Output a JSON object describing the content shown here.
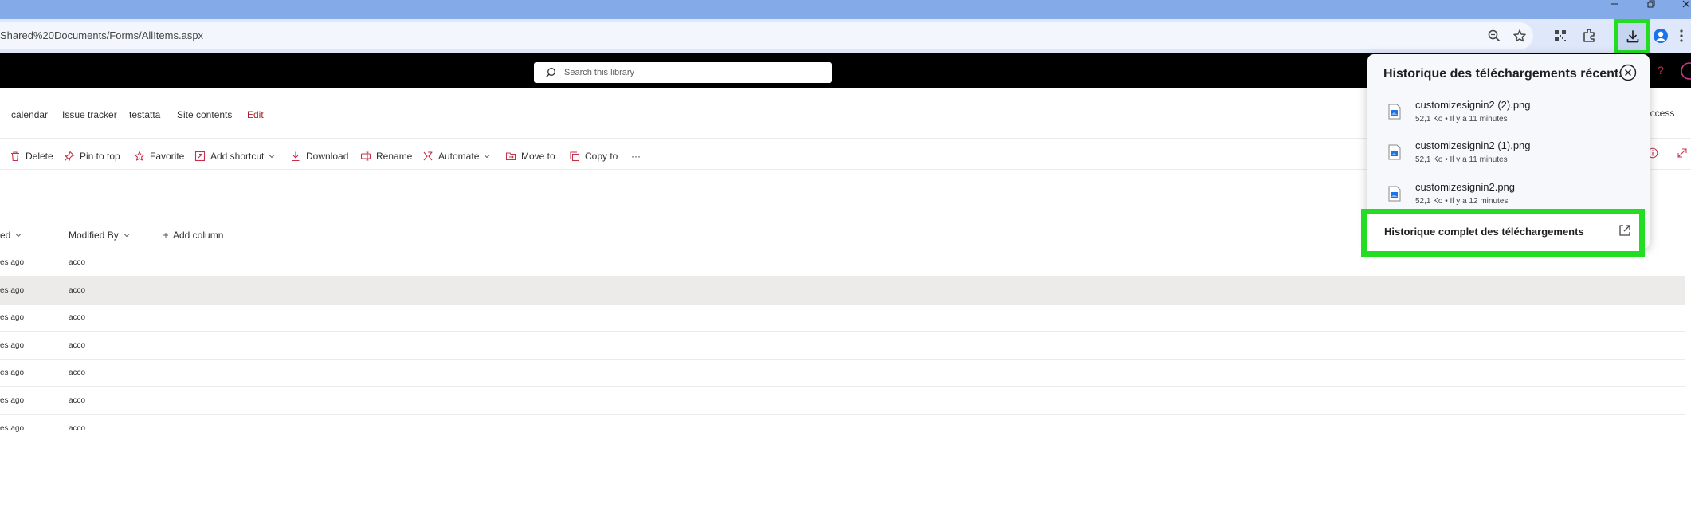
{
  "browser": {
    "url": "Shared%20Documents/Forms/AllItems.aspx",
    "window_controls": [
      "minimize",
      "restore",
      "close"
    ],
    "accent_highlight": "#22dd22"
  },
  "suite_bar": {
    "search_placeholder": "Search this library"
  },
  "site_nav": {
    "items": [
      "calendar",
      "Issue tracker",
      "testatta",
      "Site contents"
    ],
    "edit_label": "Edit",
    "right_label": "access"
  },
  "command_bar": {
    "items": [
      {
        "label": "Delete",
        "icon": "trash-icon"
      },
      {
        "label": "Pin to top",
        "icon": "pin-icon"
      },
      {
        "label": "Favorite",
        "icon": "star-icon"
      },
      {
        "label": "Add shortcut",
        "icon": "shortcut-icon"
      },
      {
        "label": "Download",
        "icon": "download-icon"
      },
      {
        "label": "Rename",
        "icon": "rename-icon"
      },
      {
        "label": "Automate",
        "icon": "automate-icon"
      },
      {
        "label": "Move to",
        "icon": "move-icon"
      },
      {
        "label": "Copy to",
        "icon": "copy-icon"
      }
    ],
    "more_label": "···"
  },
  "list": {
    "columns": {
      "modified": "ed",
      "modified_by": "Modified By",
      "add_column": "Add column"
    },
    "rows": [
      {
        "modified": "es ago",
        "modified_by": "acco"
      },
      {
        "modified": "es ago",
        "modified_by": "acco"
      },
      {
        "modified": "es ago",
        "modified_by": "acco"
      },
      {
        "modified": "es ago",
        "modified_by": "acco"
      },
      {
        "modified": "es ago",
        "modified_by": "acco"
      },
      {
        "modified": "es ago",
        "modified_by": "acco"
      },
      {
        "modified": "es ago",
        "modified_by": "acco"
      }
    ],
    "selected_row": 1
  },
  "downloads_popup": {
    "title": "Historique des téléchargements récents",
    "items": [
      {
        "name": "customizesignin2 (2).png",
        "meta": "52,1 Ko • Il y a 11 minutes"
      },
      {
        "name": "customizesignin2 (1).png",
        "meta": "52,1 Ko • Il y a 11 minutes"
      },
      {
        "name": "customizesignin2.png",
        "meta": "52,1 Ko • Il y a 12 minutes"
      }
    ],
    "full_history_label": "Historique complet des téléchargements"
  }
}
